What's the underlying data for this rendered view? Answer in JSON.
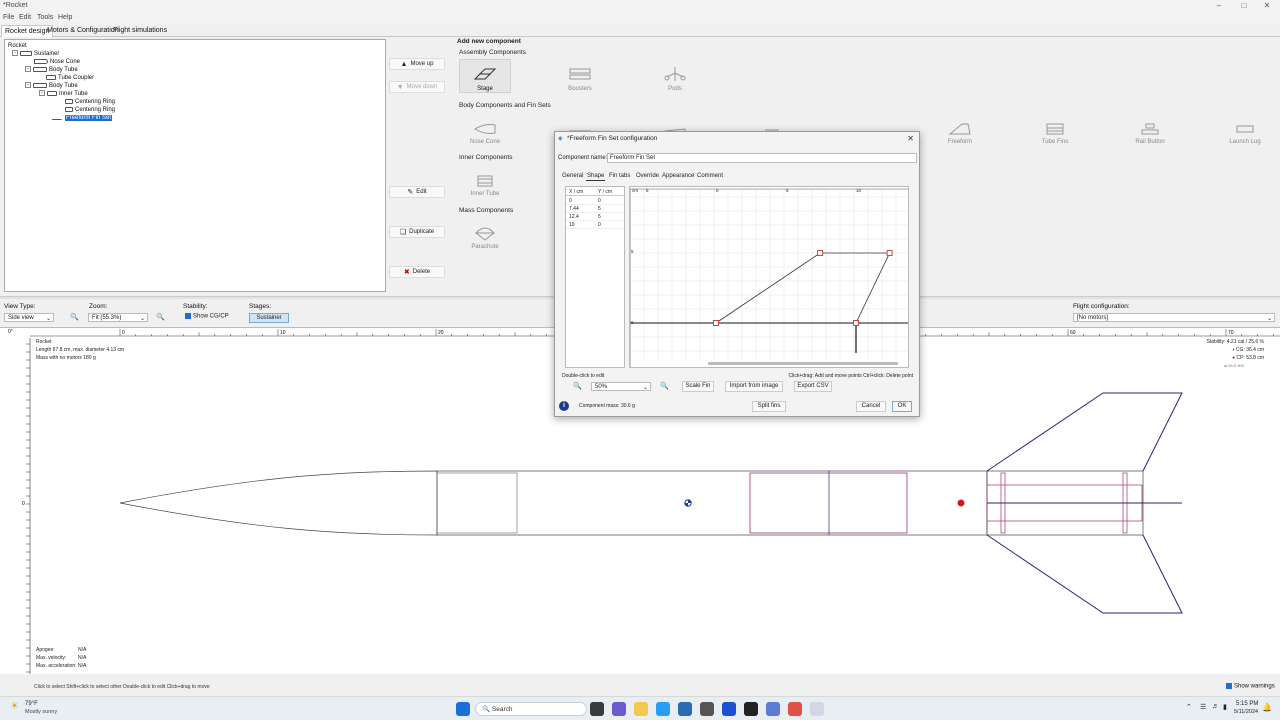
{
  "window": {
    "title": "*Rocket"
  },
  "menu": [
    "File",
    "Edit",
    "Tools",
    "Help"
  ],
  "tabs": [
    "Rocket design",
    "Motors & Configuration",
    "Flight simulations"
  ],
  "tree": {
    "rocket": "Rocket",
    "sustainer": "Sustainer",
    "nose_cone": "Nose Cone",
    "body_tube_1": "Body Tube",
    "tube_coupler": "Tube Coupler",
    "body_tube_2": "Body Tube",
    "inner_tube": "Inner Tube",
    "centering_ring_1": "Centering Ring",
    "centering_ring_2": "Centering Ring",
    "freeform_fin_set": "Freeform Fin Set"
  },
  "side_buttons": {
    "move_up": "Move up",
    "move_down": "Move down",
    "edit": "Edit",
    "duplicate": "Duplicate",
    "delete": "Delete"
  },
  "add_component": {
    "title": "Add new component",
    "assembly_label": "Assembly Components",
    "assembly": [
      "Stage",
      "Boosters",
      "Pods"
    ],
    "body_label": "Body Components and Fin Sets",
    "body": [
      "Nose Cone",
      "Freeform",
      "Tube Fins",
      "Rail Button",
      "Launch Lug"
    ],
    "inner_label": "Inner Components",
    "inner": [
      "Inner Tube"
    ],
    "mass_label": "Mass Components",
    "mass": [
      "Parachute"
    ]
  },
  "view": {
    "view_type_label": "View Type:",
    "view_type_value": "Side view",
    "zoom_label": "Zoom:",
    "zoom_value": "Fit (55.3%)",
    "stability_label": "Stability:",
    "show_cgcp": "Show CG/CP",
    "stages_label": "Stages:",
    "stage_value": "Sustainer",
    "flight_config_label": "Flight configuration:",
    "flight_config_value": "[No motors]"
  },
  "info": {
    "name": "Rocket",
    "length": "Length 67.8 cm, max. diameter 4.13 cm",
    "mass": "Mass with no motors 180 g",
    "stability": "Stability: 4.21 cal / 25.6 %",
    "cg": "CG: 36.4 cm",
    "cp": "CP: 53.8 cm",
    "aoa": "at M=0.300",
    "apogee_label": "Apogee:",
    "apogee_value": "N/A",
    "maxvel_label": "Max. velocity:",
    "maxvel_value": "N/A",
    "maxacc_label": "Max. acceleration:",
    "maxacc_value": "N/A"
  },
  "ruler": {
    "top": [
      "0",
      "10",
      "20",
      "30",
      "40",
      "50",
      "60",
      "70"
    ],
    "left_origin": "0",
    "corner": "0°"
  },
  "status": {
    "hint": "Click to select    Shift+click to select other    Double-click to edit    Click+drag to move",
    "show_warnings": "Show warnings"
  },
  "dialog": {
    "title": "*Freeform Fin Set configuration",
    "name_label": "Component name:",
    "name_value": "Freeform Fin Set",
    "tabs": [
      "General",
      "Shape",
      "Fin tabs",
      "Override",
      "Appearance",
      "Comment"
    ],
    "col_x": "X / cm",
    "col_y": "Y / cm",
    "points": [
      [
        "0",
        "0"
      ],
      [
        "7.44",
        "5"
      ],
      [
        "12.4",
        "5"
      ],
      [
        "10",
        "0"
      ]
    ],
    "plot_unit": "cm",
    "plot_ticks": [
      "5",
      "0",
      "5",
      "10"
    ],
    "plot_y_ticks": [
      "5",
      "0"
    ],
    "hint_left": "Double-click to edit",
    "hint_right": "Click+drag: Add and move points   Ctrl+click: Delete point",
    "zoom_value": "50%",
    "scale_fin": "Scale Fin",
    "import_image": "Import from image",
    "export_csv": "Export CSV",
    "mass": "Component mass: 30.6 g",
    "split_fins": "Split fins",
    "cancel": "Cancel",
    "ok": "OK"
  },
  "taskbar": {
    "weather_temp": "79°F",
    "weather_desc": "Mostly sunny",
    "search": "Search",
    "time": "5:15 PM",
    "date": "5/11/2024"
  }
}
